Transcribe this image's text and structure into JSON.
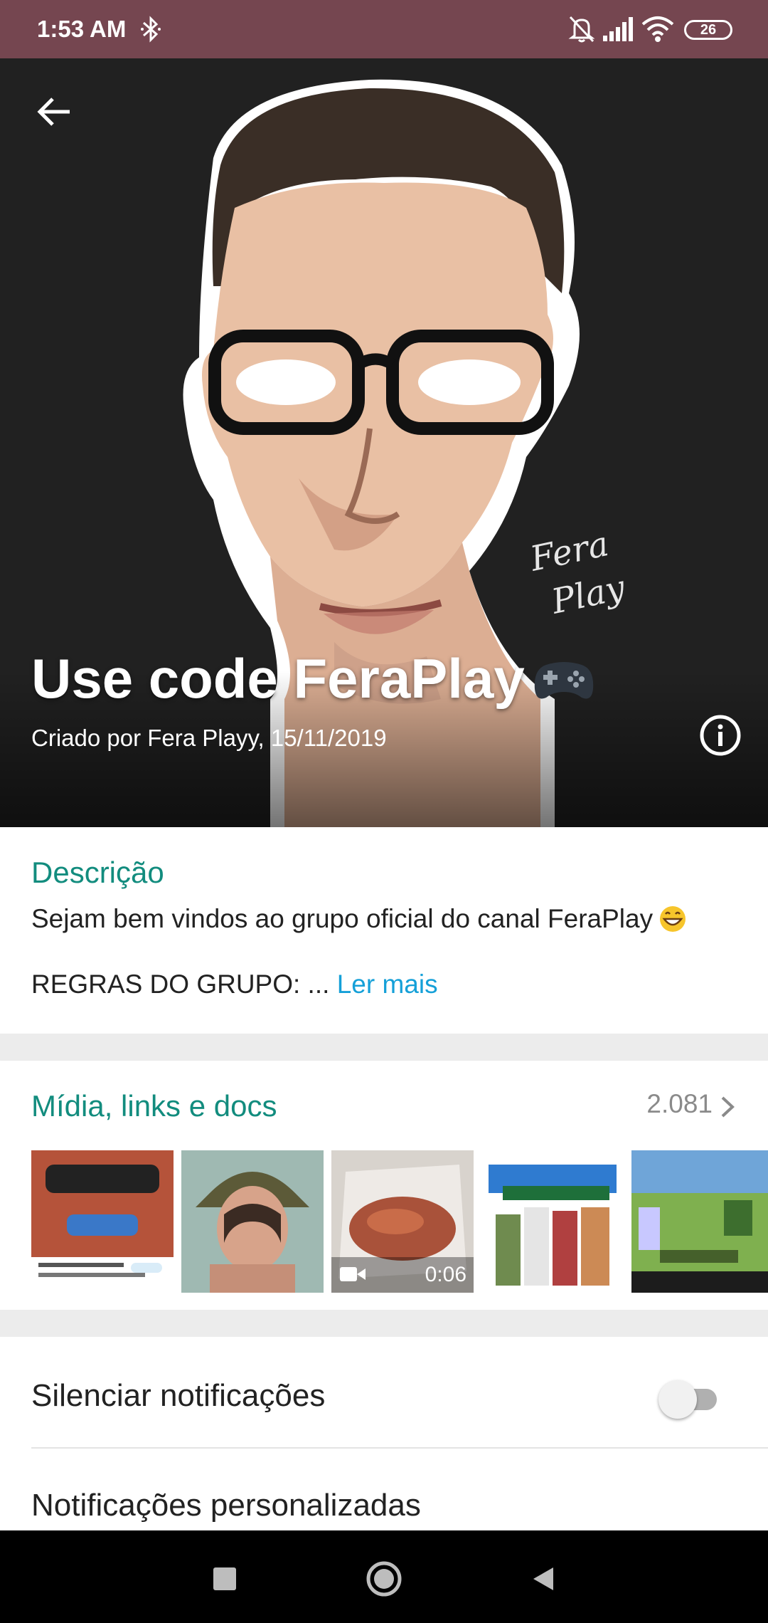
{
  "status_bar": {
    "time": "1:53 AM",
    "battery": "26",
    "icons": [
      "bluetooth-icon",
      "bell-off-icon",
      "signal-icon",
      "wifi-icon",
      "battery-icon"
    ]
  },
  "header": {
    "title": "Use code FeraPlay",
    "title_emoji": "game-controller-icon",
    "subtitle": "Criado por Fera Playy, 15/11/2019",
    "watermark": "Fera Play"
  },
  "description": {
    "heading": "Descrição",
    "text": "Sejam bem vindos ao grupo oficial do canal FeraPlay",
    "rules_text": "REGRAS DO GRUPO: ...",
    "read_more": "Ler mais"
  },
  "media": {
    "heading": "Mídia, links e docs",
    "count": "2.081",
    "items": [
      {
        "type": "image",
        "name": "thumb-photo-glasses"
      },
      {
        "type": "image",
        "name": "thumb-photo-hat"
      },
      {
        "type": "video",
        "duration": "0:06",
        "name": "thumb-video-food"
      },
      {
        "type": "image",
        "name": "thumb-cadillacs-dinosaurs"
      },
      {
        "type": "image",
        "name": "thumb-game-screenshot"
      }
    ]
  },
  "settings": {
    "mute_label": "Silenciar notificações",
    "mute_enabled": false,
    "custom_label": "Notificações personalizadas"
  },
  "colors": {
    "status_bar": "#754650",
    "accent": "#128C7E",
    "link": "#15a0d8"
  }
}
